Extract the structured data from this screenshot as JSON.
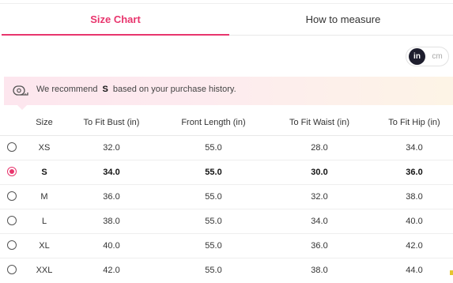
{
  "tabs": {
    "size_chart": "Size Chart",
    "how_to_measure": "How to measure",
    "active": "size_chart"
  },
  "unit_toggle": {
    "in_label": "in",
    "cm_label": "cm",
    "selected": "in"
  },
  "recommendation": {
    "prefix": "We recommend",
    "size": "S",
    "suffix": "based on your purchase history.",
    "icon": "measuring-tape-icon"
  },
  "table": {
    "headers": {
      "size": "Size",
      "bust": "To Fit Bust (in)",
      "front_length": "Front Length (in)",
      "waist": "To Fit Waist (in)",
      "hip": "To Fit Hip (in)"
    },
    "rows": [
      {
        "size": "XS",
        "bust": "32.0",
        "front_length": "55.0",
        "waist": "28.0",
        "hip": "34.0",
        "selected": false
      },
      {
        "size": "S",
        "bust": "34.0",
        "front_length": "55.0",
        "waist": "30.0",
        "hip": "36.0",
        "selected": true
      },
      {
        "size": "M",
        "bust": "36.0",
        "front_length": "55.0",
        "waist": "32.0",
        "hip": "38.0",
        "selected": false
      },
      {
        "size": "L",
        "bust": "38.0",
        "front_length": "55.0",
        "waist": "34.0",
        "hip": "40.0",
        "selected": false
      },
      {
        "size": "XL",
        "bust": "40.0",
        "front_length": "55.0",
        "waist": "36.0",
        "hip": "42.0",
        "selected": false
      },
      {
        "size": "XXL",
        "bust": "42.0",
        "front_length": "55.0",
        "waist": "38.0",
        "hip": "44.0",
        "selected": false
      }
    ]
  },
  "colors": {
    "accent": "#e8356d",
    "toggle_active": "#1e1e2e",
    "banner_start": "#fde6ee",
    "banner_end": "#fdf4e6"
  }
}
